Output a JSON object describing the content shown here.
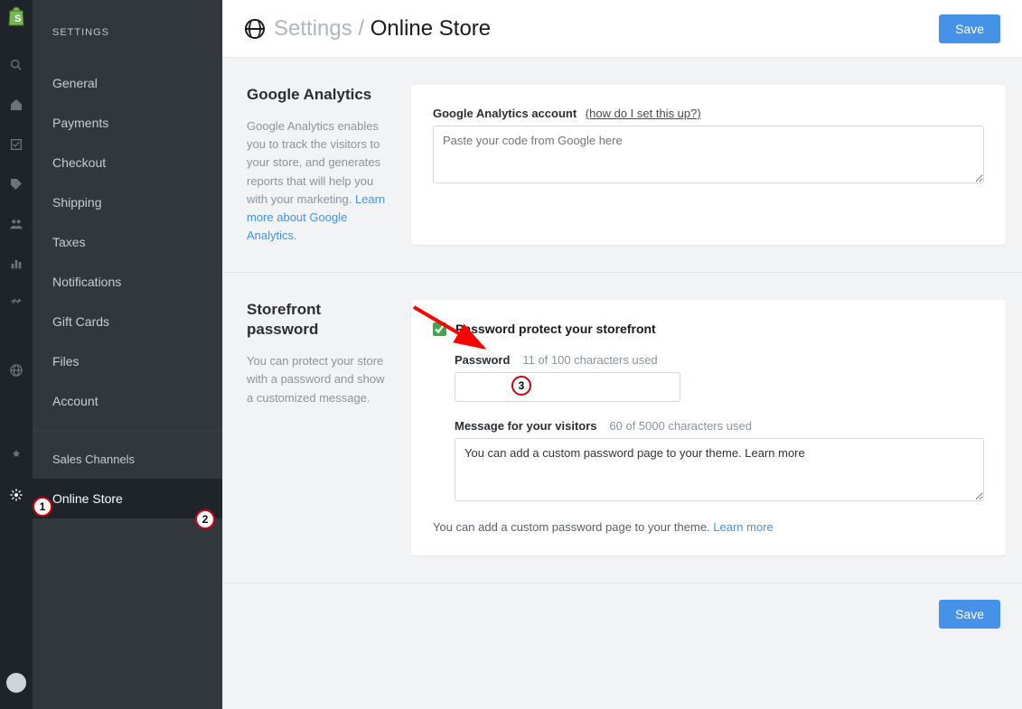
{
  "sidebar": {
    "heading": "SETTINGS",
    "items": [
      {
        "label": "General"
      },
      {
        "label": "Payments"
      },
      {
        "label": "Checkout"
      },
      {
        "label": "Shipping"
      },
      {
        "label": "Taxes"
      },
      {
        "label": "Notifications"
      },
      {
        "label": "Gift Cards"
      },
      {
        "label": "Files"
      },
      {
        "label": "Account"
      }
    ],
    "channels_heading": "Sales Channels",
    "active_item": "Online Store"
  },
  "header": {
    "breadcrumb": "Settings /",
    "title": "Online Store",
    "save": "Save"
  },
  "ga": {
    "title": "Google Analytics",
    "desc_pre": "Google Analytics enables you to track the visitors to your store, and generates reports that will help you with your marketing. ",
    "desc_link": "Learn more about Google Analytics.",
    "account_label": "Google Analytics account",
    "help_link": "(how do I set this up?)",
    "placeholder": "Paste your code from Google here"
  },
  "pw": {
    "title": "Storefront password",
    "desc": "You can protect your store with a password and show a customized message.",
    "checkbox_label": "Password protect your storefront",
    "password_label": "Password",
    "password_hint": "11 of 100 characters used",
    "message_label": "Message for your visitors",
    "message_hint": "60 of 5000 characters used",
    "message_value": "You can add a custom password page to your theme. Learn more",
    "note_pre": "You can add a custom password page to your theme. ",
    "note_link": "Learn more"
  },
  "footer": {
    "save": "Save"
  },
  "annotations": {
    "a1": "1",
    "a2": "2",
    "a3": "3"
  }
}
